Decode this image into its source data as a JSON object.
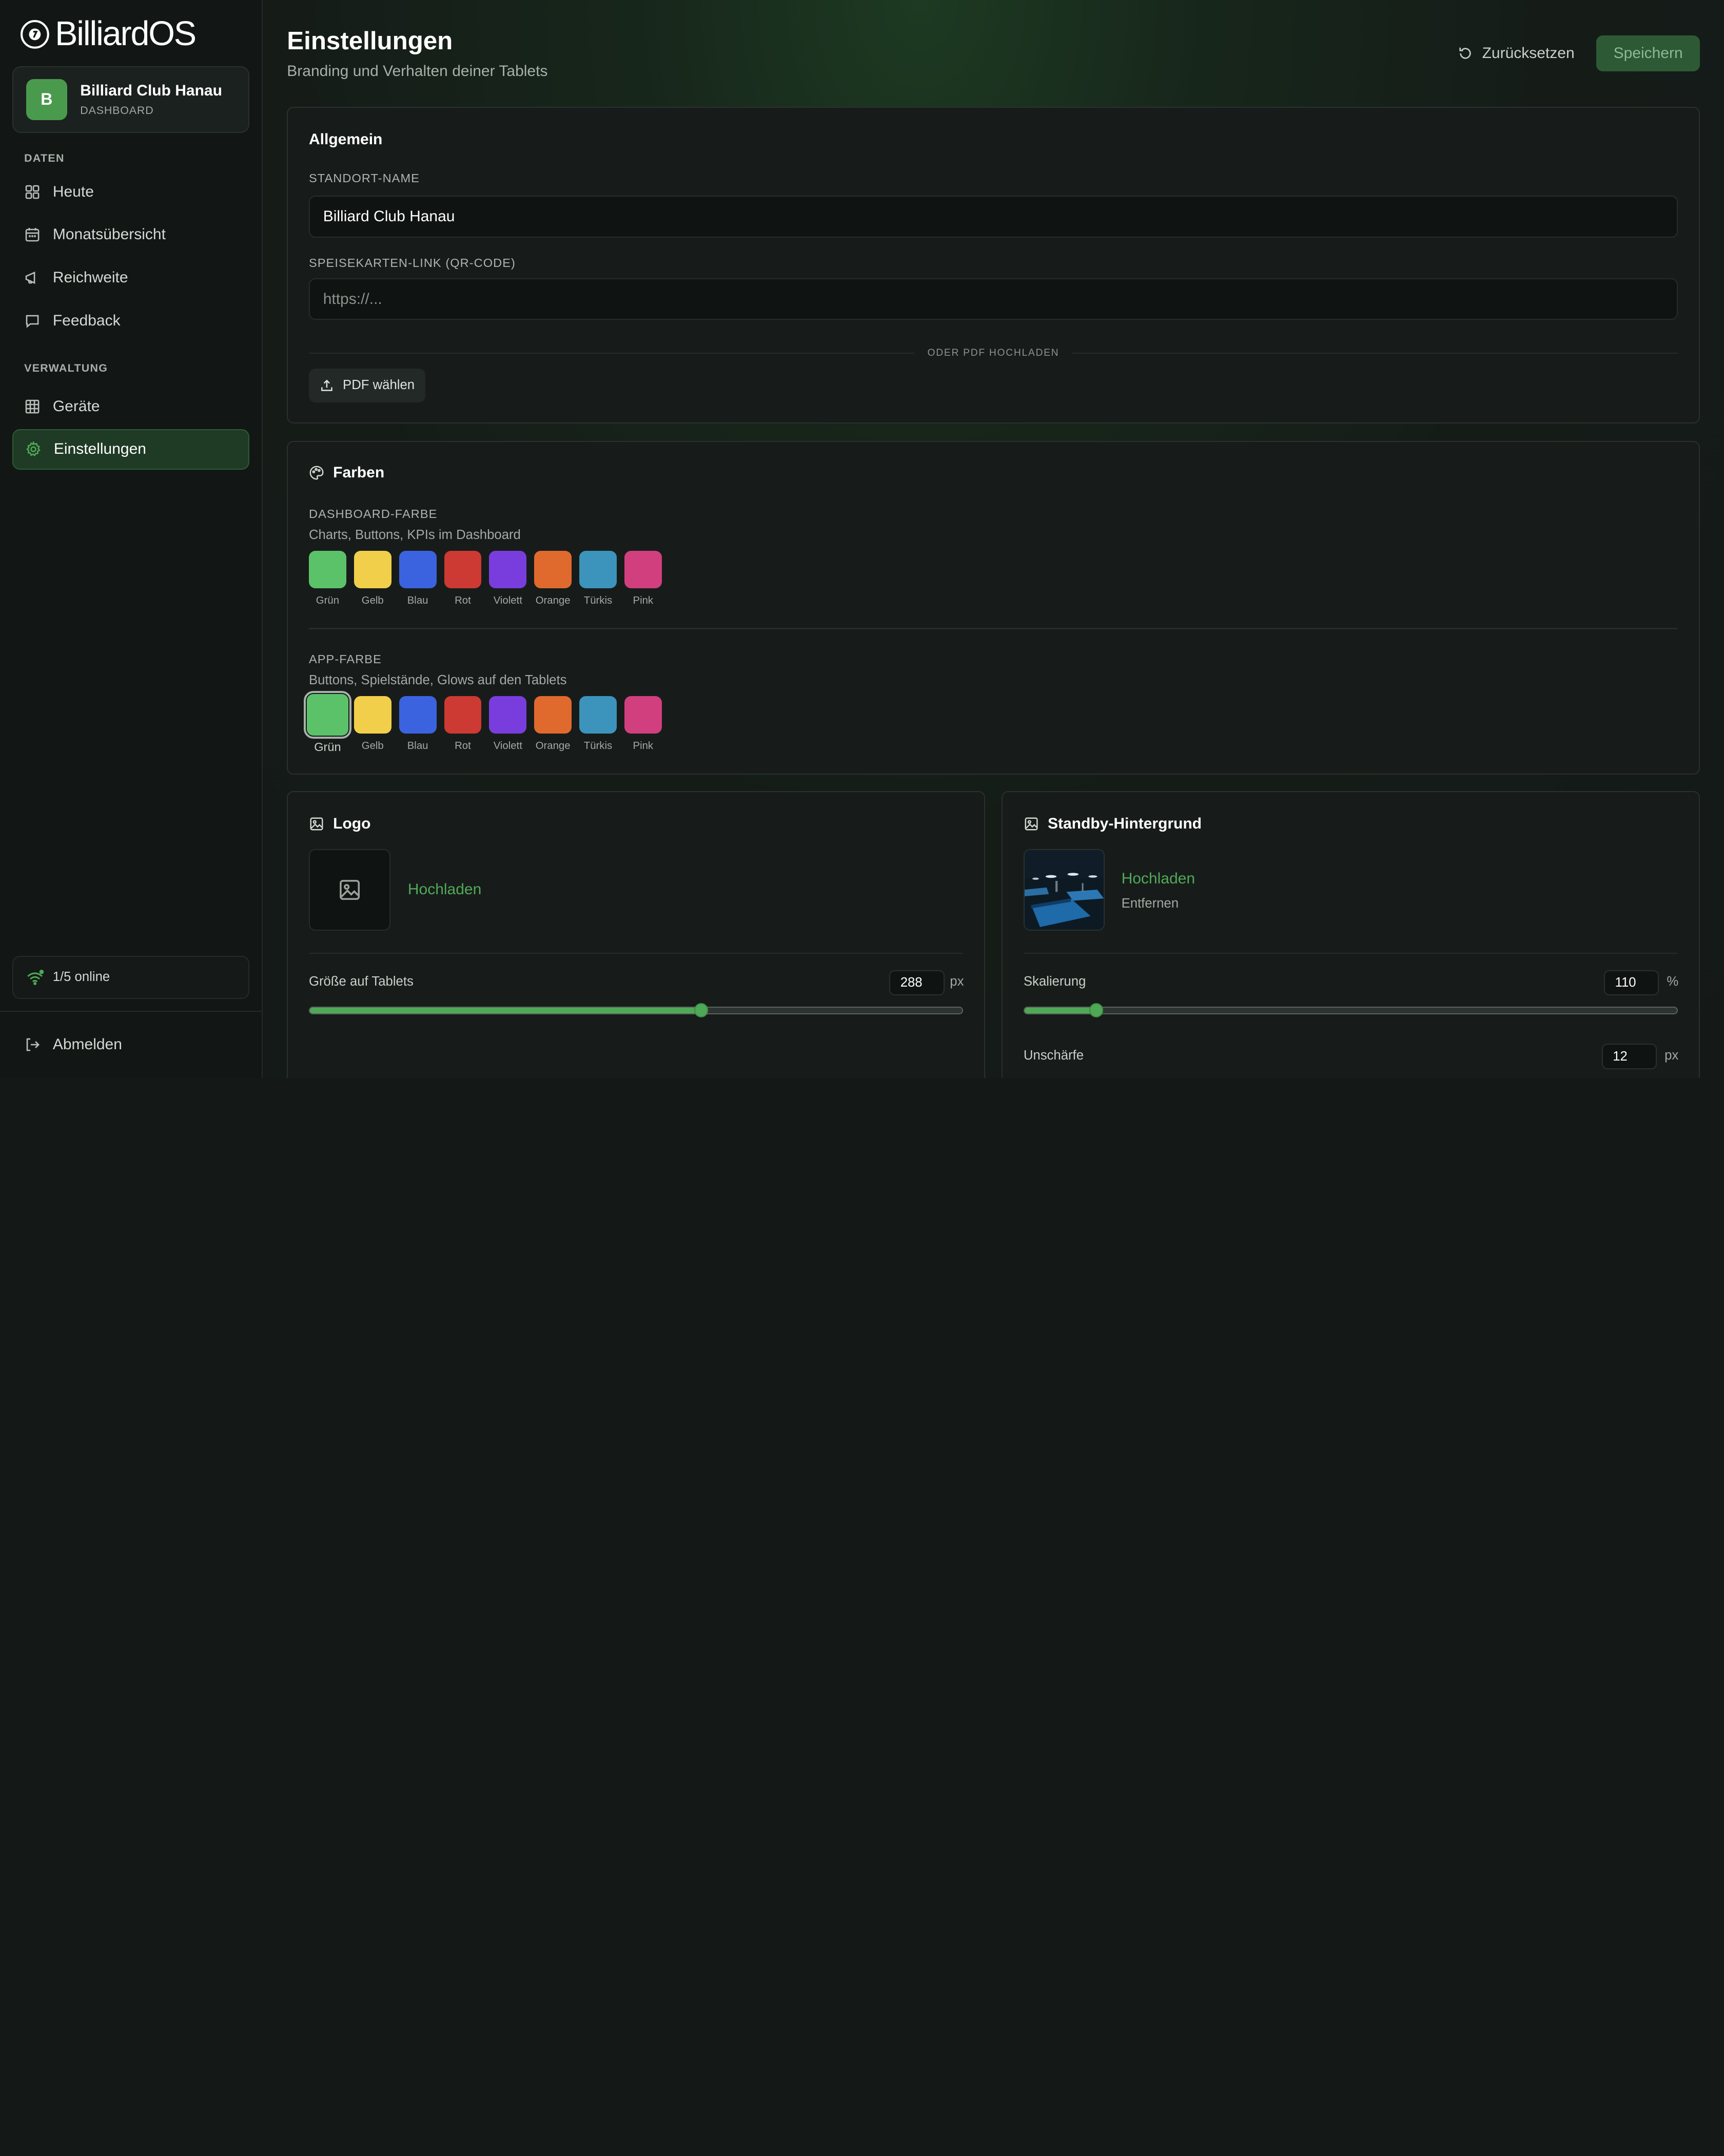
{
  "brand": {
    "name": "BilliardOS"
  },
  "club": {
    "initial": "B",
    "name": "Billiard Club Hanau",
    "subtitle": "DASHBOARD"
  },
  "sidebar": {
    "sections": [
      {
        "title": "DATEN",
        "items": [
          {
            "label": "Heute",
            "icon": "grid-icon"
          },
          {
            "label": "Monatsübersicht",
            "icon": "calendar-icon"
          },
          {
            "label": "Reichweite",
            "icon": "megaphone-icon"
          },
          {
            "label": "Feedback",
            "icon": "message-icon"
          }
        ]
      },
      {
        "title": "VERWALTUNG",
        "items": [
          {
            "label": "Geräte",
            "icon": "table-icon"
          },
          {
            "label": "Einstellungen",
            "icon": "gear-icon",
            "active": true
          }
        ]
      }
    ],
    "online_status": "1/5 online",
    "logout_label": "Abmelden"
  },
  "header": {
    "title": "Einstellungen",
    "subtitle": "Branding und Verhalten deiner Tablets",
    "reset_label": "Zurücksetzen",
    "save_label": "Speichern"
  },
  "general": {
    "title": "Allgemein",
    "location_label": "STANDORT-NAME",
    "location_value": "Billiard Club Hanau",
    "menu_link_label": "SPEISEKARTEN-LINK (QR-CODE)",
    "menu_link_placeholder": "https://...",
    "or_label": "ODER PDF HOCHLADEN",
    "pdf_button": "PDF wählen"
  },
  "colors": {
    "title": "Farben",
    "dashboard": {
      "label": "DASHBOARD-FARBE",
      "help": "Charts, Buttons, KPIs im Dashboard",
      "selected": null
    },
    "app": {
      "label": "APP-FARBE",
      "help": "Buttons, Spielstände, Glows auf den Tablets",
      "selected": "Grün"
    },
    "swatches": [
      {
        "name": "Grün",
        "hex": "#5cc26a"
      },
      {
        "name": "Gelb",
        "hex": "#f2cf4a"
      },
      {
        "name": "Blau",
        "hex": "#3b63e0"
      },
      {
        "name": "Rot",
        "hex": "#cc3a33"
      },
      {
        "name": "Violett",
        "hex": "#7a3ddd"
      },
      {
        "name": "Orange",
        "hex": "#e06a2e"
      },
      {
        "name": "Türkis",
        "hex": "#3c94bc"
      },
      {
        "name": "Pink",
        "hex": "#d13f7e"
      }
    ]
  },
  "logo": {
    "title": "Logo",
    "upload_label": "Hochladen",
    "size_label": "Größe auf Tablets",
    "size_value": "288",
    "size_unit": "px",
    "size_fraction": 0.6
  },
  "standby": {
    "title": "Standby-Hintergrund",
    "upload_label": "Hochladen",
    "remove_label": "Entfernen",
    "scale_label": "Skalierung",
    "scale_value": "110",
    "scale_unit": "%",
    "scale_fraction": 0.11,
    "blur_label": "Unschärfe",
    "blur_value": "12",
    "blur_unit": "px"
  },
  "accent_color": "#4fa856"
}
